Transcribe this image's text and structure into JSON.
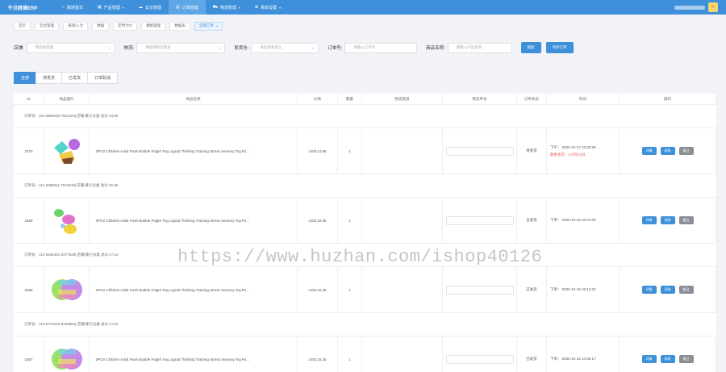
{
  "app": {
    "brand": "牛贝跨境ERP"
  },
  "nav": [
    {
      "icon": "home-icon",
      "glyph": "⌂",
      "label": "跨境首页",
      "dropdown": false,
      "active": false
    },
    {
      "icon": "grid-icon",
      "glyph": "▦",
      "label": "产品管理",
      "dropdown": true,
      "active": false
    },
    {
      "icon": "cloud-icon",
      "glyph": "☁",
      "label": "云仓管理",
      "dropdown": false,
      "active": false
    },
    {
      "icon": "cart-icon",
      "glyph": "▤",
      "label": "订单管理",
      "dropdown": false,
      "active": true
    },
    {
      "icon": "truck-icon",
      "glyph": "⛟",
      "label": "物流管理",
      "dropdown": true,
      "active": false
    },
    {
      "icon": "gear-icon",
      "glyph": "✿",
      "label": "系统设置",
      "dropdown": true,
      "active": false
    }
  ],
  "tabs": [
    {
      "label": "首页",
      "active": false
    },
    {
      "label": "云仓管理",
      "active": false
    },
    {
      "label": "采购/入仓",
      "active": false
    },
    {
      "label": "数据",
      "active": false
    },
    {
      "label": "定时计价",
      "active": false
    },
    {
      "label": "模板管理",
      "active": false
    },
    {
      "label": "数据表",
      "active": false
    },
    {
      "label": "全部订单",
      "active": true,
      "close": "×"
    }
  ],
  "filters": {
    "shop": {
      "label": "店铺:",
      "placeholder": "请选择店铺"
    },
    "logistics": {
      "label": "物流:",
      "placeholder": "请选择物流渠道"
    },
    "warehouse": {
      "label": "发货仓:",
      "placeholder": "请选择发货仓"
    },
    "order_no": {
      "label": "订单号:",
      "placeholder": "请输入订单号"
    },
    "product": {
      "label": "商品名称:",
      "placeholder": "请输入产品名称"
    },
    "search_button": "搜索",
    "sync_button": "同步订单"
  },
  "status_tabs": [
    {
      "label": "全部",
      "active": true
    },
    {
      "label": "待发货",
      "active": false
    },
    {
      "label": "已发货",
      "active": false
    },
    {
      "label": "订单取消",
      "active": false
    }
  ],
  "table": {
    "columns": [
      "ID",
      "商品图片",
      "商品名称",
      "价格",
      "数量",
      "物流渠道",
      "物流单号",
      "订单状态",
      "时间",
      "操作"
    ],
    "orders": [
      {
        "header": "订单号：111-5969818-7631403|  店铺:库仑分类  总价:14.96",
        "id": "1570",
        "product_name": "3PCS Children Adult Push Bubble Fidget Toy,Logical Thinking Training Stress Sensory Toy,Po...",
        "price": "USD:14.96",
        "qty": "1",
        "status": "待发货",
        "time": "下午： 2020-12-17 23:25:29",
        "warning": "剩余发货：4小时12分",
        "image": "pieces"
      },
      {
        "header": "订单号：112-4085811-7815218|  店铺:库仑分类  总价:15.96",
        "id": "1569",
        "product_name": "3PCS Children Adult Push Bubble Fidget Toy,Logical Thinking Training Stress Sensory Toy,Po...",
        "price": "USD:15.96",
        "qty": "1",
        "status": "已发货",
        "time": "下单： 2020-12-16 10:31:06",
        "warning": "",
        "image": "hearts"
      },
      {
        "header": "订单号：112-5403401-2077020|  店铺:库仑分类  总价:17.22",
        "id": "1568",
        "product_name": "3PCS Children Adult Push Bubble Fidget Toy,Logical Thinking Training Stress Sensory Toy,Po...",
        "price": "USD:15.36",
        "qty": "1",
        "status": "已发货",
        "time": "下单： 2020-12-16 10:14:32",
        "warning": "",
        "image": "rainbow"
      },
      {
        "header": "订单号：113-0772430-9340881|  店铺:库仑分类  总价:17.02",
        "id": "1567",
        "product_name": "3PCS Children Adult Push Bubble Fidget Toy,Logical Thinking Training Stress Sensory Toy,Po...",
        "price": "USD:15.36",
        "qty": "1",
        "status": "已发货",
        "time": "下单： 2020-12-16 14:39:17",
        "warning": "",
        "image": "rainbow"
      }
    ],
    "op_buttons": {
      "detail": "详情",
      "purchase": "采购",
      "remark": "备注"
    }
  },
  "watermark": "https://www.huzhan.com/ishop40126",
  "colors": {
    "primary": "#3e90da",
    "warning": "#e05555",
    "gray_button": "#8a8f97"
  }
}
